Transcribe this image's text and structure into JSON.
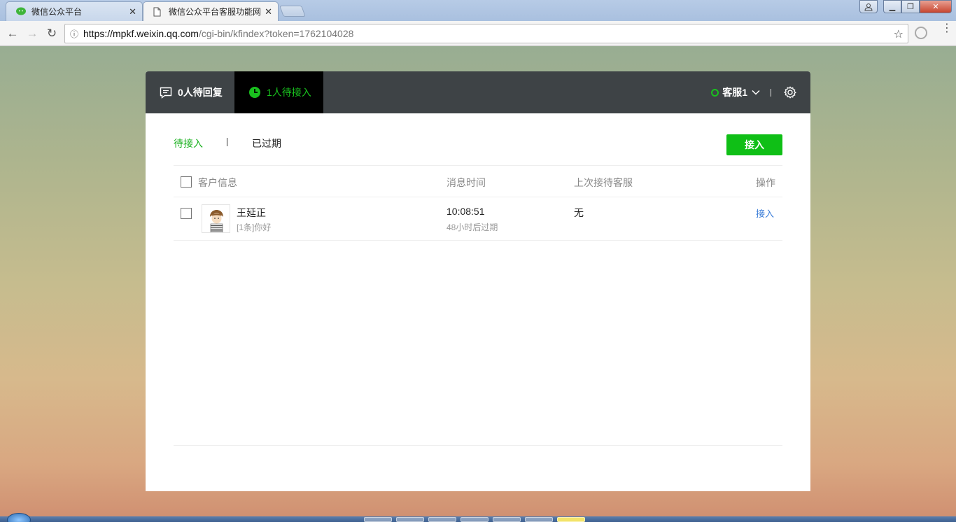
{
  "browser": {
    "tabs": [
      {
        "title": "微信公众平台",
        "active": false
      },
      {
        "title": "微信公众平台客服功能网",
        "active": true
      }
    ],
    "url_host": "https://mpkf.weixin.qq.com",
    "url_path": "/cgi-bin/kfindex?token=1762104028"
  },
  "header": {
    "pending_reply": "0人待回复",
    "waiting_accept": "1人待接入",
    "agent_name": "客服1",
    "colors": {
      "bar": "#3e4346",
      "active_tab": "#000000",
      "accent": "#19c11e"
    }
  },
  "subtabs": {
    "pending": "待接入",
    "expired": "已过期"
  },
  "accept_all_label": "接入",
  "table": {
    "headers": {
      "customer": "客户信息",
      "time": "消息时间",
      "last_agent": "上次接待客服",
      "action": "操作"
    },
    "rows": [
      {
        "name": "王延正",
        "message": "[1条]你好",
        "time": "10:08:51",
        "expire": "48小时后过期",
        "last_agent": "无",
        "action": "接入"
      }
    ]
  }
}
